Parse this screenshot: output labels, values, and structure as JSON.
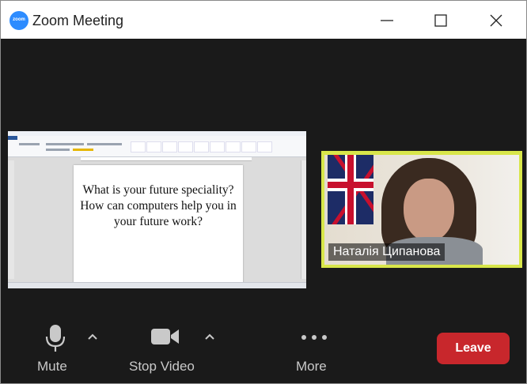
{
  "window": {
    "title": "Zoom Meeting",
    "logo_text": "zoom",
    "controls": [
      "minimize-icon",
      "maximize-icon",
      "close-icon"
    ]
  },
  "shared_screen": {
    "app": "Microsoft Word",
    "document_text": "What is your future speciality? How can computers help you in your future work?"
  },
  "participant": {
    "name": "Наталія Ципанова",
    "highlight_color": "#d8e64a"
  },
  "toolbar": {
    "mute_label": "Mute",
    "stop_video_label": "Stop Video",
    "more_label": "More",
    "leave_label": "Leave"
  },
  "colors": {
    "zoom_blue": "#2d8cff",
    "leave_red": "#c8272c",
    "background": "#1a1a1a"
  }
}
